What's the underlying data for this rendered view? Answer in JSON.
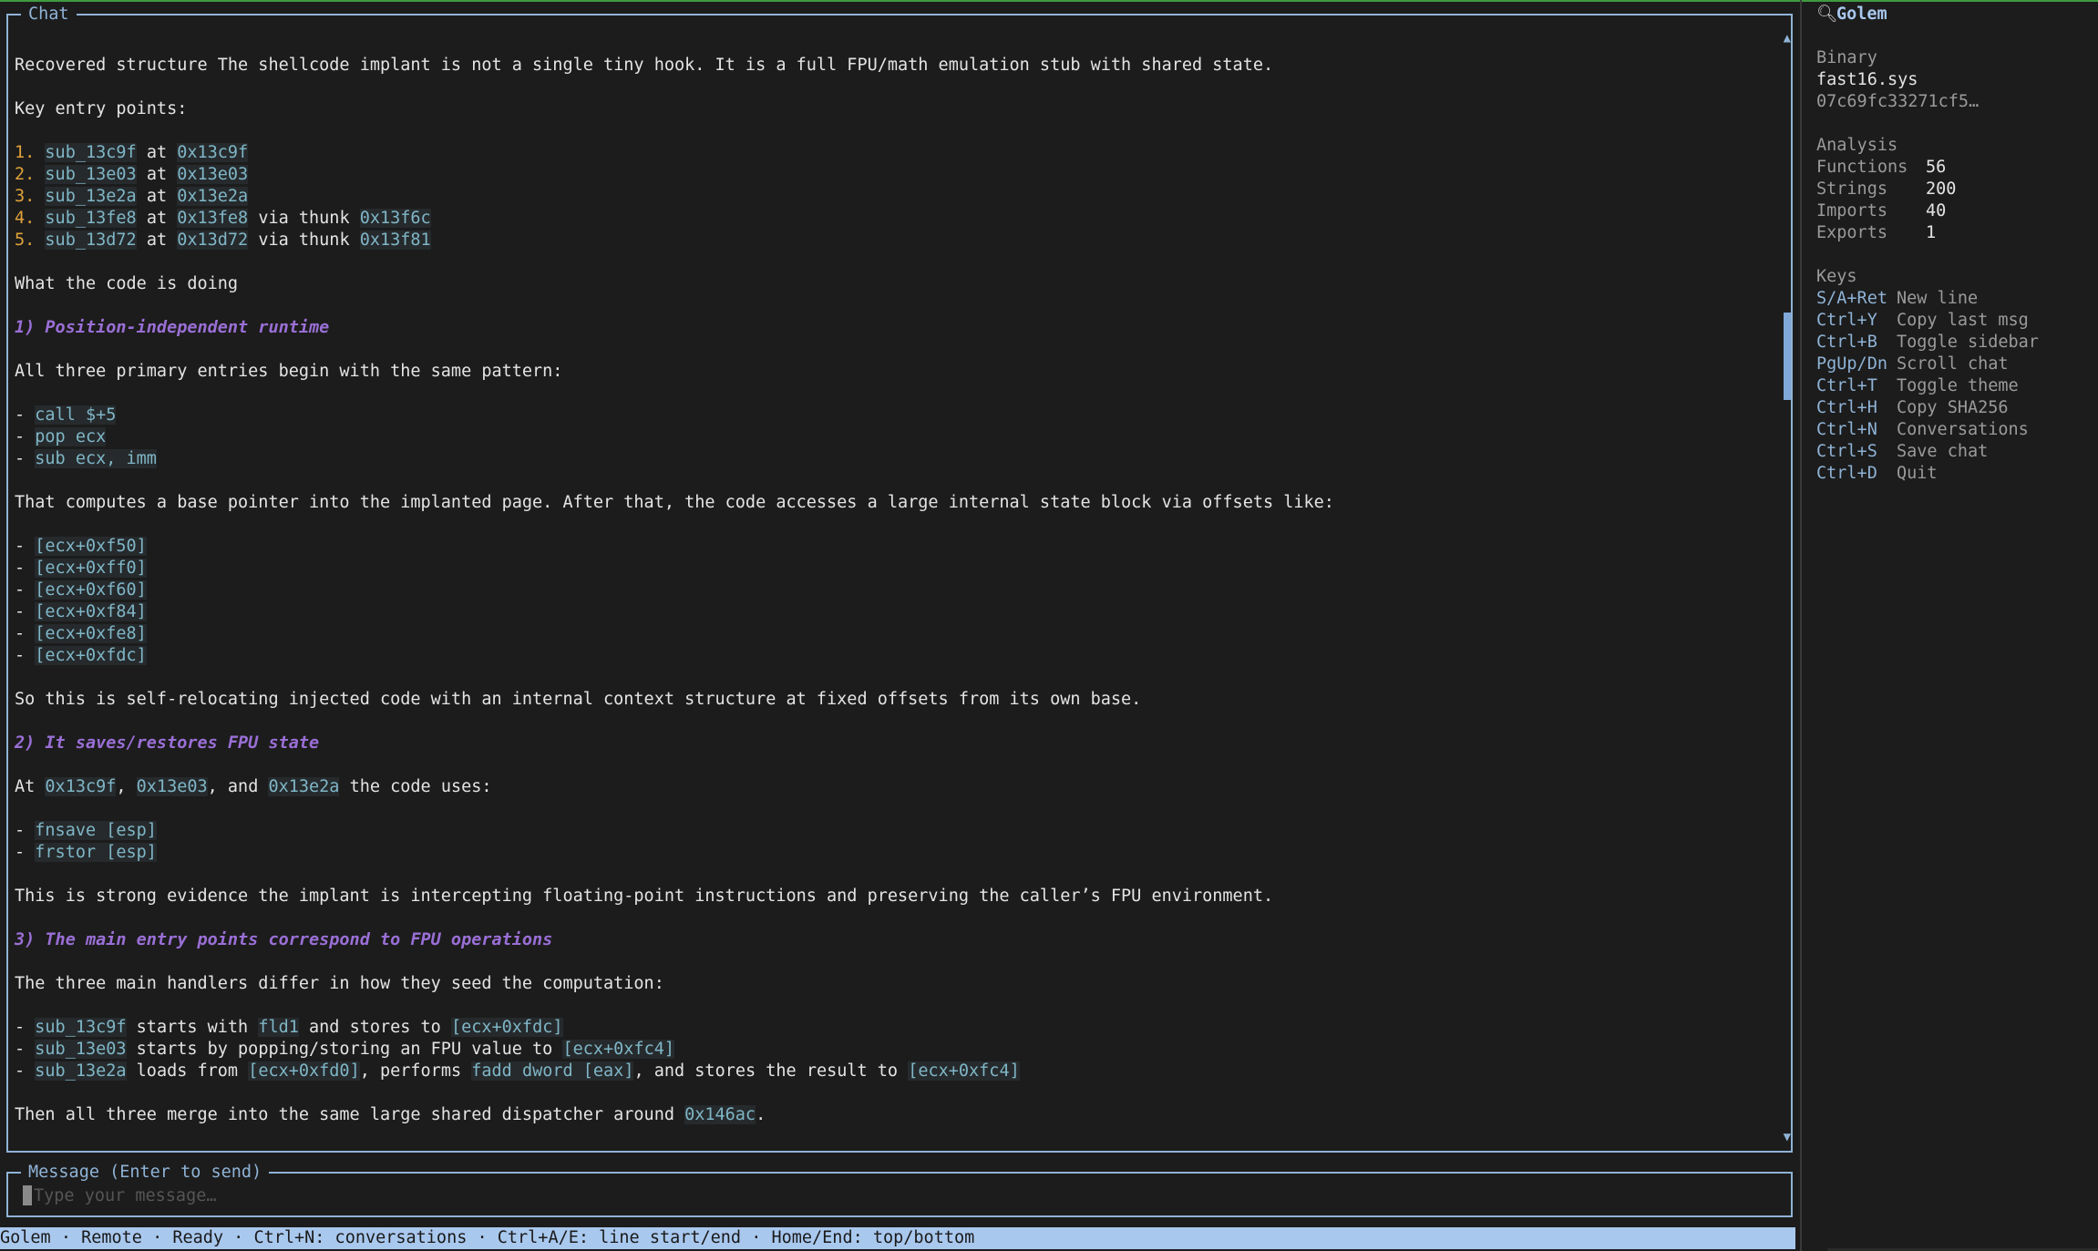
{
  "chat": {
    "title": "Chat",
    "intro": "Recovered structure The shellcode implant is not a single tiny hook. It is a full FPU/math emulation stub with shared state.",
    "key_entry_points_label": "Key entry points:",
    "entry_points": [
      {
        "num": "1.",
        "name": "sub_13c9f",
        "at": "at",
        "addr": "0x13c9f",
        "via": "",
        "thunk": ""
      },
      {
        "num": "2.",
        "name": "sub_13e03",
        "at": "at",
        "addr": "0x13e03",
        "via": "",
        "thunk": ""
      },
      {
        "num": "3.",
        "name": "sub_13e2a",
        "at": "at",
        "addr": "0x13e2a",
        "via": "",
        "thunk": ""
      },
      {
        "num": "4.",
        "name": "sub_13fe8",
        "at": "at",
        "addr": "0x13fe8",
        "via": "via thunk",
        "thunk": "0x13f6c"
      },
      {
        "num": "5.",
        "name": "sub_13d72",
        "at": "at",
        "addr": "0x13d72",
        "via": "via thunk",
        "thunk": "0x13f81"
      }
    ],
    "what_label": "What the code is doing",
    "h1": "1) Position-independent runtime",
    "p1": "All three primary entries begin with the same pattern:",
    "pattern": [
      "call $+5",
      "pop ecx",
      "sub ecx, imm"
    ],
    "p2": "That computes a base pointer into the implanted page. After that, the code accesses a large internal state block via offsets like:",
    "offsets": [
      "[ecx+0xf50]",
      "[ecx+0xff0]",
      "[ecx+0xf60]",
      "[ecx+0xf84]",
      "[ecx+0xfe8]",
      "[ecx+0xfdc]"
    ],
    "p3": "So this is self-relocating injected code with an internal context structure at fixed offsets from its own base.",
    "h2": "2) It saves/restores FPU state",
    "p4": {
      "pre": "At ",
      "a1": "0x13c9f",
      "s1": ", ",
      "a2": "0x13e03",
      "s2": ", and ",
      "a3": "0x13e2a",
      "post": " the code uses:"
    },
    "fpu_ops": [
      "fnsave [esp]",
      "frstor [esp]"
    ],
    "p5": "This is strong evidence the implant is intercepting floating-point instructions and preserving the caller’s FPU environment.",
    "h3": "3) The main entry points correspond to FPU operations",
    "p6": "The three main handlers differ in how they seed the computation:",
    "handlers": {
      "h1": {
        "name": "sub_13c9f",
        "t1": " starts with ",
        "c1": "fld1",
        "t2": " and stores to ",
        "c2": "[ecx+0xfdc]"
      },
      "h2": {
        "name": "sub_13e03",
        "t1": " starts by popping/storing an FPU value to ",
        "c1": "[ecx+0xfc4]"
      },
      "h3": {
        "name": "sub_13e2a",
        "t1": " loads from ",
        "c1": "[ecx+0xfd0]",
        "t2": ", performs ",
        "c2": "fadd dword [eax]",
        "t3": ", and stores the result to ",
        "c3": "[ecx+0xfc4]"
      }
    },
    "p7": {
      "pre": "Then all three merge into the same large shared dispatcher around ",
      "addr": "0x146ac",
      "post": "."
    }
  },
  "input": {
    "title": "Message (Enter to send)",
    "placeholder": "Type your message…",
    "value": ""
  },
  "statusbar": "Golem · Remote · Ready · Ctrl+N: conversations · Ctrl+A/E: line start/end · Home/End: top/bottom",
  "sidebar": {
    "title": "Golem",
    "title_icon": "magnifier-icon",
    "binary_label": "Binary",
    "binary_name": "fast16.sys",
    "binary_hash": "07c69fc33271cf5…",
    "analysis_label": "Analysis",
    "analysis": [
      {
        "key": "Functions",
        "val": "56"
      },
      {
        "key": "Strings",
        "val": "200"
      },
      {
        "key": "Imports",
        "val": "40"
      },
      {
        "key": "Exports",
        "val": "1"
      }
    ],
    "keys_label": "Keys",
    "keys": [
      {
        "key": "S/A+Ret",
        "desc": "New line"
      },
      {
        "key": "Ctrl+Y",
        "desc": "Copy last msg"
      },
      {
        "key": "Ctrl+B",
        "desc": "Toggle sidebar"
      },
      {
        "key": "PgUp/Dn",
        "desc": "Scroll chat"
      },
      {
        "key": "Ctrl+T",
        "desc": "Toggle theme"
      },
      {
        "key": "Ctrl+H",
        "desc": "Copy SHA256"
      },
      {
        "key": "Ctrl+N",
        "desc": "Conversations"
      },
      {
        "key": "Ctrl+S",
        "desc": "Save chat"
      },
      {
        "key": "Ctrl+D",
        "desc": "Quit"
      }
    ]
  },
  "colors": {
    "accent": "#8fb3d6",
    "status_bg": "#a9c8ee",
    "code": "#7fb6c7",
    "heading": "#9a6fd6",
    "list_number": "#e0a23a"
  }
}
